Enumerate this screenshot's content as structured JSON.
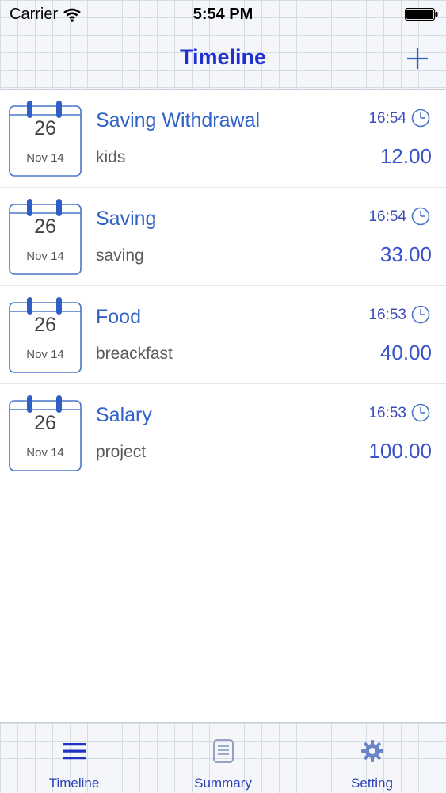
{
  "status_bar": {
    "carrier": "Carrier",
    "time": "5:54 PM"
  },
  "nav": {
    "title": "Timeline"
  },
  "entries": [
    {
      "day": "26",
      "month": "Nov 14",
      "title": "Saving Withdrawal",
      "note": "kids",
      "time": "16:54",
      "amount": "12.00"
    },
    {
      "day": "26",
      "month": "Nov 14",
      "title": "Saving",
      "note": "saving",
      "time": "16:54",
      "amount": "33.00"
    },
    {
      "day": "26",
      "month": "Nov 14",
      "title": "Food",
      "note": "breackfast",
      "time": "16:53",
      "amount": "40.00"
    },
    {
      "day": "26",
      "month": "Nov 14",
      "title": "Salary",
      "note": "project",
      "time": "16:53",
      "amount": "100.00"
    }
  ],
  "tabs": [
    {
      "label": "Timeline",
      "icon": "list-icon"
    },
    {
      "label": "Summary",
      "icon": "document-icon"
    },
    {
      "label": "Setting",
      "icon": "gear-icon"
    }
  ],
  "colors": {
    "accent": "#1f2fd0",
    "title_text": "#2f63c8",
    "amount_text": "#3a53c8"
  }
}
